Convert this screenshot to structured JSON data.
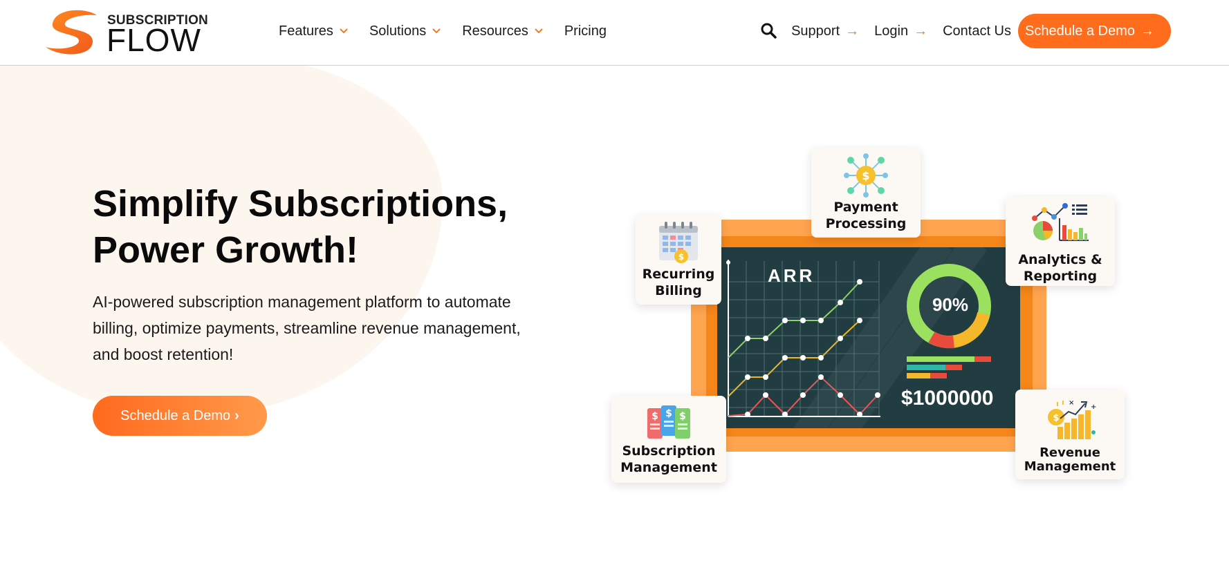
{
  "logo": {
    "top_text": "SUBSCRIPTION",
    "main_text": "FLOW"
  },
  "nav": {
    "items": [
      {
        "label": "Features",
        "has_dropdown": true
      },
      {
        "label": "Solutions",
        "has_dropdown": true
      },
      {
        "label": "Resources",
        "has_dropdown": true
      },
      {
        "label": "Pricing",
        "has_dropdown": false
      }
    ]
  },
  "right_nav": {
    "search_icon": "search-icon",
    "support": "Support",
    "login": "Login",
    "contact": "Contact Us",
    "cta": "Schedule a Demo",
    "arrow": "→"
  },
  "hero": {
    "title_line1": "Simplify Subscriptions,",
    "title_line2": "Power Growth!",
    "subtitle": "AI-powered subscription management platform to automate billing, optimize payments, streamline revenue management, and boost retention!",
    "cta": "Schedule a Demo",
    "cta_chevron": "›"
  },
  "illustration": {
    "board_title": "ARR",
    "donut_percent": "90%",
    "amount": "$1000000",
    "cards": {
      "payment": [
        "Payment",
        "Processing"
      ],
      "billing": [
        "Recurring",
        "Billing"
      ],
      "analytics": [
        "Analytics &",
        "Reporting"
      ],
      "subscription": [
        "Subscription",
        "Management"
      ],
      "revenue": [
        "Revenue",
        "Management"
      ]
    }
  },
  "colors": {
    "accent": "#ff6d1c",
    "board": "#223d42",
    "board_frame": "#f5861a"
  }
}
